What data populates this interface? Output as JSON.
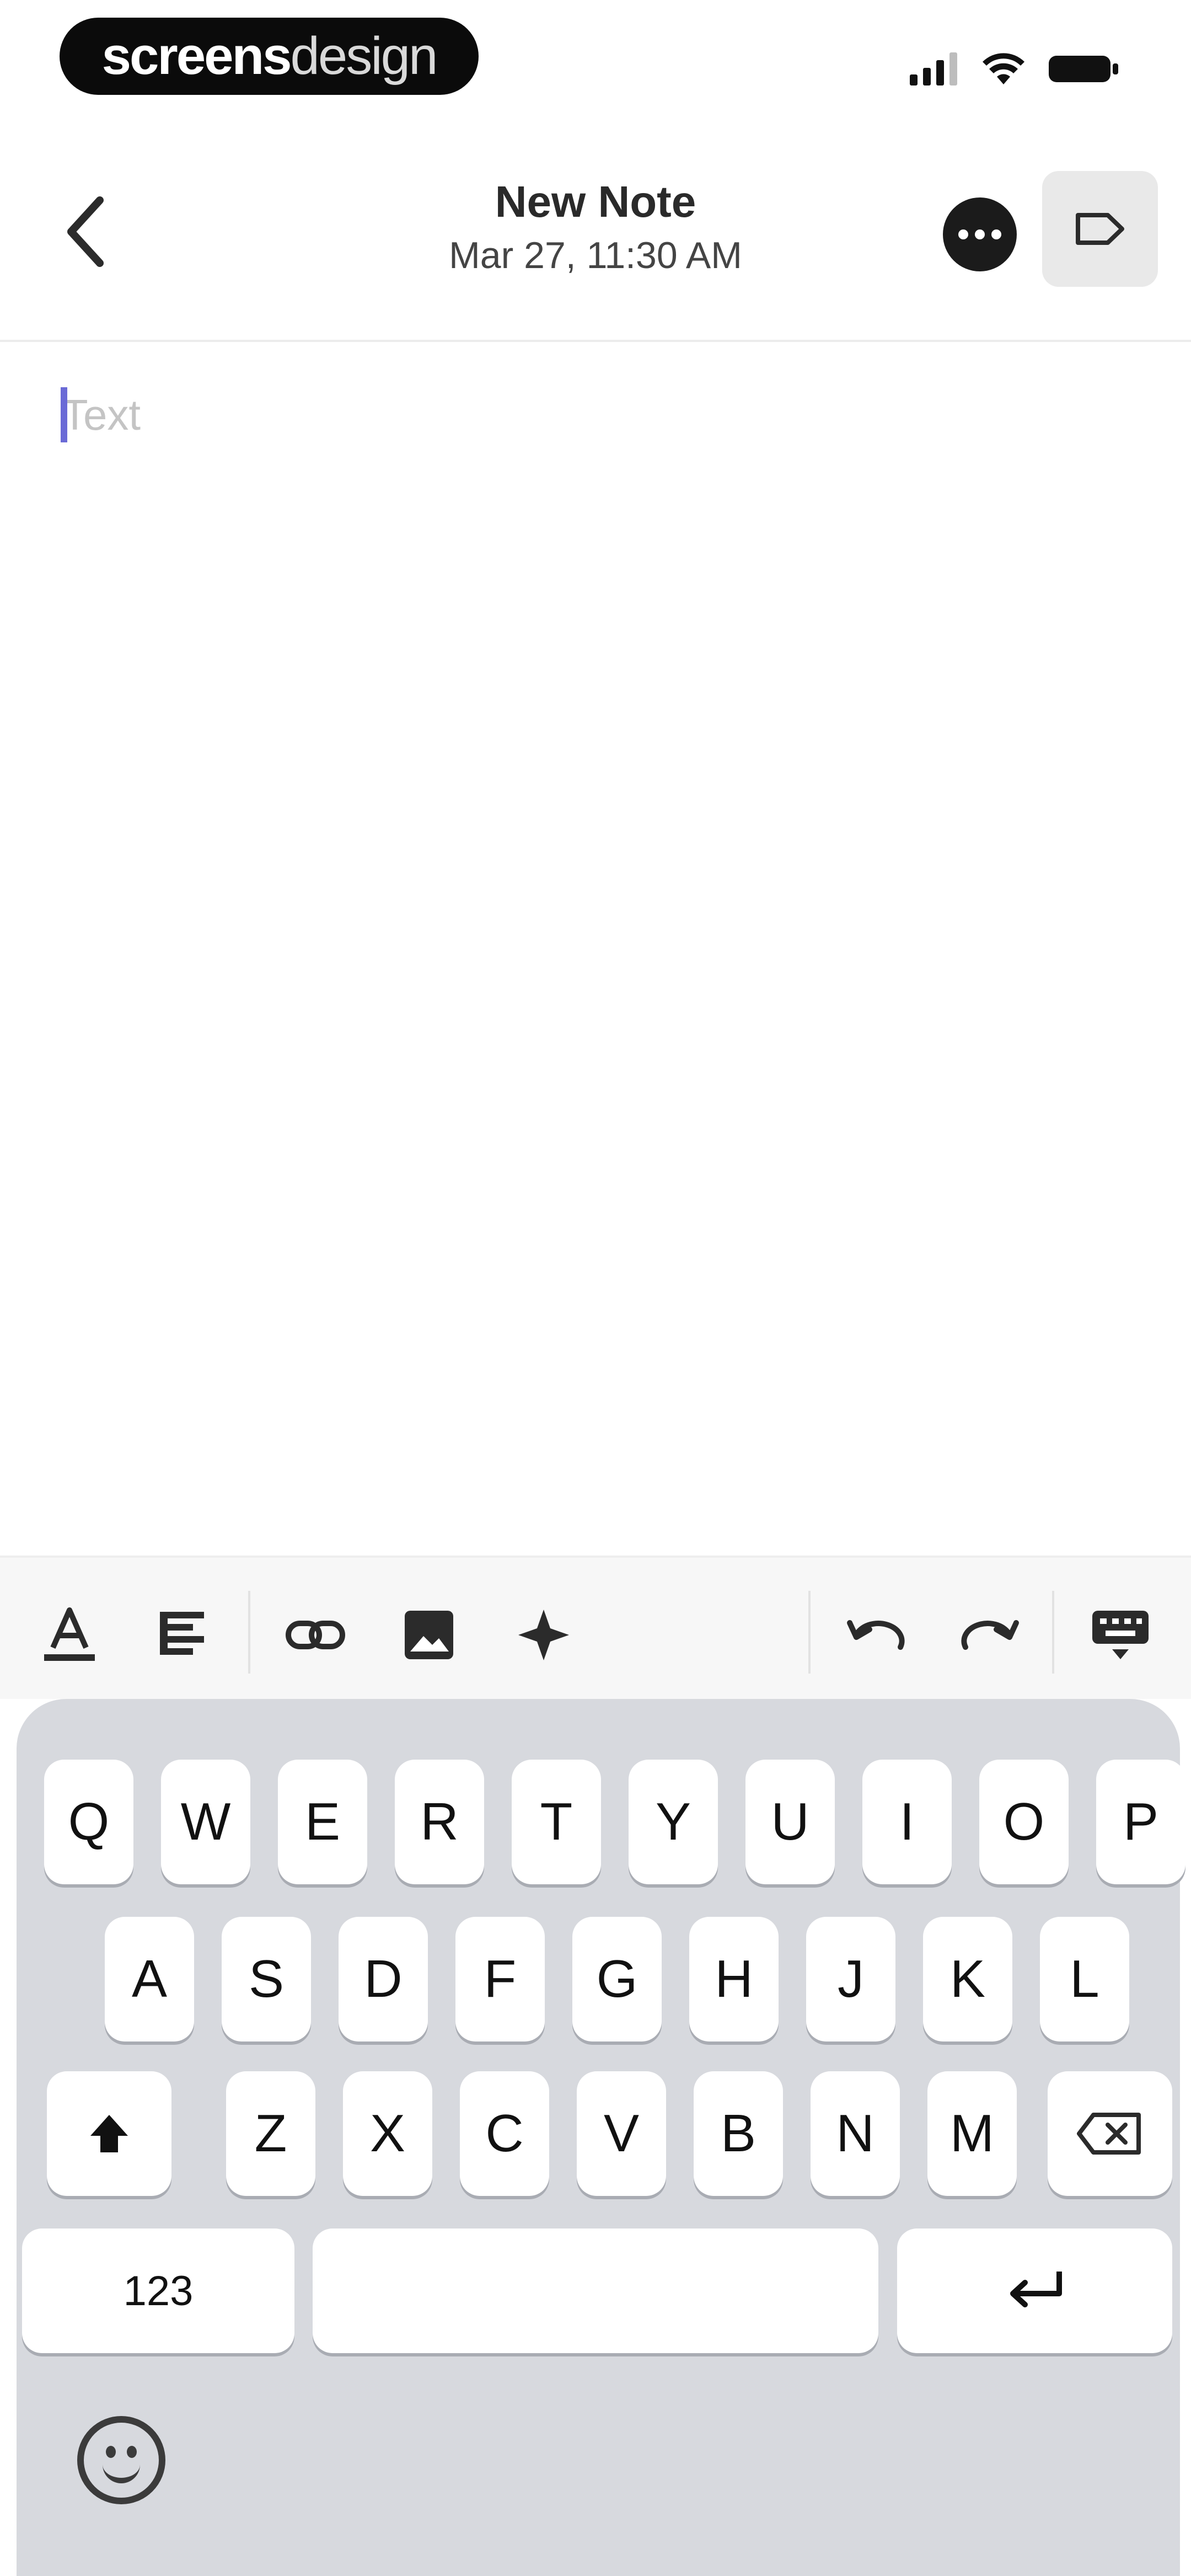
{
  "status_bar": {
    "brand_part1": "screens",
    "brand_part2": "design"
  },
  "nav": {
    "title": "New Note",
    "subtitle": "Mar 27, 11:30 AM"
  },
  "editor": {
    "placeholder": "Text"
  },
  "toolbar": {
    "icons": [
      "text-color-icon",
      "align-icon",
      "link-icon",
      "image-icon",
      "sparkle-icon",
      "undo-icon",
      "redo-icon",
      "keyboard-dismiss-icon"
    ]
  },
  "keyboard": {
    "row1": [
      "Q",
      "W",
      "E",
      "R",
      "T",
      "Y",
      "U",
      "I",
      "O",
      "P"
    ],
    "row2": [
      "A",
      "S",
      "D",
      "F",
      "G",
      "H",
      "J",
      "K",
      "L"
    ],
    "row3": [
      "Z",
      "X",
      "C",
      "V",
      "B",
      "N",
      "M"
    ],
    "numbers_label": "123"
  }
}
